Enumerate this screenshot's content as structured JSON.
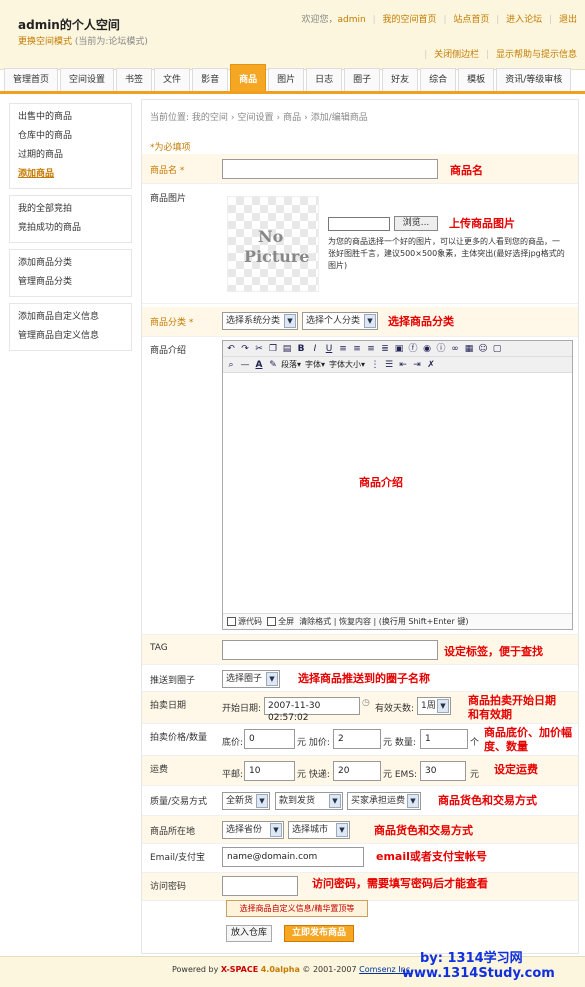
{
  "header": {
    "site_title": "admin的个人空间",
    "mode_link": "更换空间模式",
    "mode_note": "(当前为:论坛模式)",
    "welcome": "欢迎您，",
    "user": "admin",
    "links": [
      "我的空间首页",
      "站点首页",
      "进入论坛",
      "退出"
    ],
    "sub_links": [
      "关闭侧边栏",
      "显示帮助与提示信息"
    ]
  },
  "tabs": [
    "管理首页",
    "空间设置",
    "书签",
    "文件",
    "影音",
    "商品",
    "图片",
    "日志",
    "圈子",
    "好友",
    "综合",
    "模板",
    "资讯/等级审核"
  ],
  "active_tab": "商品",
  "sidebar": {
    "groups": [
      [
        "出售中的商品",
        "仓库中的商品",
        "过期的商品",
        "添加商品"
      ],
      [
        "我的全部竞拍",
        "竞拍成功的商品"
      ],
      [
        "添加商品分类",
        "管理商品分类"
      ],
      [
        "添加商品自定义信息",
        "管理商品自定义信息"
      ]
    ],
    "active_item": "添加商品"
  },
  "breadcrumb": [
    "当前位置: 我的空间",
    "空间设置",
    "商品",
    "添加/编辑商品"
  ],
  "form": {
    "required_note": "*为必填项",
    "name_label": "商品名 *",
    "name_value": "",
    "image_label": "商品图片",
    "no_picture_1": "No",
    "no_picture_2": "Picture",
    "browse": "浏览...",
    "image_hint": "为您的商品选择一个好的图片，可以让更多的人看到您的商品，一张好图胜千言，建议500×500象素，主体突出(最好选择jpg格式的图片)",
    "category_label": "商品分类 *",
    "category_system": "选择系统分类",
    "category_personal": "选择个人分类",
    "intro_label": "商品介绍",
    "toolbar_text": [
      "段落",
      "字体",
      "字体大小"
    ],
    "editor_bottom": "源代码",
    "editor_bottom2": "全屏",
    "editor_bottom3": "清除格式 | 恢复内容 | (换行用 Shift+Enter 键)",
    "tag_label": "TAG",
    "push_label": "推送到圈子",
    "push_select": "选择圈子",
    "date_label": "拍卖日期",
    "start_label": "开始日期:",
    "start_value": "2007-11-30 02:57:02",
    "valid_label": "有效天数:",
    "valid_value": "1周",
    "price_label": "拍卖价格/数量",
    "base_label": "底价:",
    "base_value": "0",
    "add_label": "元 加价:",
    "add_value": "2",
    "qty_label": "元 数量:",
    "qty_value": "1",
    "qty_unit": "个",
    "ship_label": "运费",
    "mail_label": "平邮:",
    "mail_value": "10",
    "express_label": "元 快递:",
    "express_value": "20",
    "ems_label": "元 EMS:",
    "ems_value": "30",
    "ems_unit": "元",
    "quality_label": "质量/交易方式",
    "quality_select": "全新货",
    "pay_select": "款到发货",
    "fee_select": "买家承担运费",
    "location_label": "商品所在地",
    "province_select": "选择省份",
    "city_select": "选择城市",
    "email_label": "Email/支付宝",
    "email_value": "name@domain.com",
    "password_label": "访问密码",
    "custom_button": "选择商品自定义信息/精华置顶等",
    "store_button": "放入仓库",
    "publish_button": "立即发布商品"
  },
  "annotations": {
    "name": "商品名",
    "image": "上传商品图片",
    "category": "选择商品分类",
    "intro": "商品介绍",
    "tag": "设定标签，便于查找",
    "push": "选择商品推送到的圈子名称",
    "date1": "商品拍卖开始日期",
    "date2": "和有效期",
    "price1": "商品底价、加价幅",
    "price2": "度、数量",
    "ship": "设定运费",
    "quality": "商品货色和交易方式",
    "location": "商品货色和交易方式",
    "email": "email或者支付宝帐号",
    "password": "访问密码，需要填写密码后才能查看"
  },
  "footer": {
    "powered": "Powered by",
    "brand": "X-SPACE",
    "version": "4.0alpha",
    "copyright": "© 2001-2007",
    "company": "Comsenz Inc."
  },
  "watermark": {
    "line1": "by: 1314学习网",
    "line2": "www.1314Study.com"
  }
}
